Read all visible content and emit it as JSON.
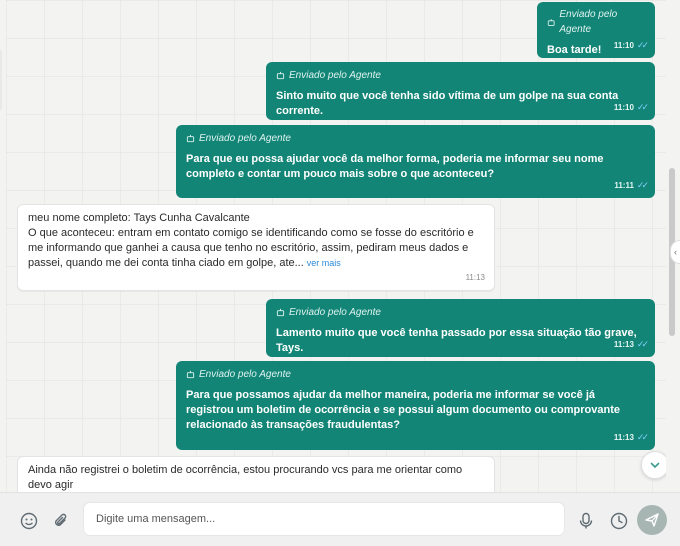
{
  "messages": [
    {
      "direction": "out",
      "agent_label": "Enviado pelo Agente",
      "text": "Boa tarde!",
      "time": "11:10"
    },
    {
      "direction": "out",
      "agent_label": "Enviado pelo Agente",
      "text": "Sinto muito que você tenha sido vítima de um golpe na sua conta corrente.",
      "time": "11:10"
    },
    {
      "direction": "out",
      "agent_label": "Enviado pelo Agente",
      "text": "Para que eu possa ajudar você da melhor forma, poderia me informar seu nome completo e contar um pouco mais sobre o que aconteceu?",
      "time": "11:11"
    },
    {
      "direction": "in",
      "text": "meu nome completo: Tays Cunha Cavalcante\nO que aconteceu: entram em contato comigo se identificando como se fosse do escritório e me informando que ganhei a causa que tenho no escritório, assim, pediram meus dados e passei, quando me dei conta tinha ciado em golpe, ate...",
      "see_more": "ver mais",
      "time": "11:13"
    },
    {
      "direction": "out",
      "agent_label": "Enviado pelo Agente",
      "text": "Lamento muito que você tenha passado por essa situação tão grave, Tays.",
      "time": "11:13"
    },
    {
      "direction": "out",
      "agent_label": "Enviado pelo Agente",
      "text": "Para que possamos ajudar da melhor maneira, poderia me informar se você já registrou um boletim de ocorrência e se possui algum documento ou comprovante relacionado às transações fraudulentas?",
      "time": "11:13"
    },
    {
      "direction": "in",
      "text": "Ainda não registrei o boletim de ocorrência, estou procurando vcs para me orientar como devo agir"
    }
  ],
  "composer": {
    "placeholder": "Digite uma mensagem...",
    "icons": [
      "emoji-icon",
      "attach-icon",
      "mic-icon",
      "clock-icon",
      "send-icon"
    ]
  },
  "colors": {
    "outgoing_bubble": "#138577",
    "incoming_bubble": "#ffffff",
    "read_ticks": "#7fd1ff",
    "send_button": "#a8b6b3"
  }
}
